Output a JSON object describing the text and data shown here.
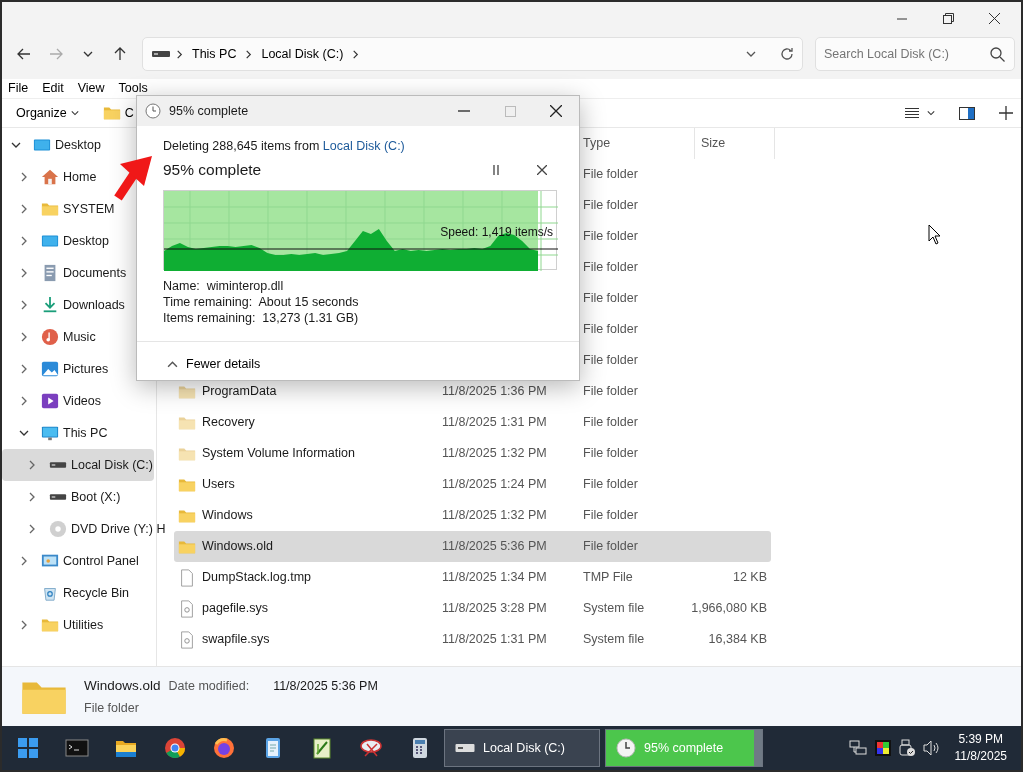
{
  "explorer": {
    "address": {
      "crumbs": [
        "This PC",
        "Local Disk (C:)"
      ]
    },
    "search": {
      "placeholder": "Search Local Disk (C:)"
    },
    "menu": [
      "File",
      "Edit",
      "View",
      "Tools"
    ],
    "command_bar": {
      "organize": "Organize",
      "partial_button": "C"
    },
    "sidebar": {
      "items": [
        {
          "label": "Desktop",
          "kind": "desktop",
          "expanded": true,
          "selected": false,
          "children": [
            {
              "label": "Home",
              "kind": "home",
              "expanded": false,
              "selected": false
            },
            {
              "label": "SYSTEM",
              "kind": "folder",
              "expanded": false,
              "selected": false
            },
            {
              "label": "Desktop",
              "kind": "desktop",
              "expanded": false,
              "selected": false
            },
            {
              "label": "Documents",
              "kind": "documents",
              "expanded": false,
              "selected": false
            },
            {
              "label": "Downloads",
              "kind": "downloads",
              "expanded": false,
              "selected": false
            },
            {
              "label": "Music",
              "kind": "music",
              "expanded": false,
              "selected": false
            },
            {
              "label": "Pictures",
              "kind": "pictures",
              "expanded": false,
              "selected": false
            },
            {
              "label": "Videos",
              "kind": "videos",
              "expanded": false,
              "selected": false
            },
            {
              "label": "This PC",
              "kind": "pc",
              "expanded": true,
              "selected": false,
              "children": [
                {
                  "label": "Local Disk (C:)",
                  "kind": "drive",
                  "expanded": false,
                  "selected": true
                },
                {
                  "label": "Boot (X:)",
                  "kind": "drive",
                  "expanded": false,
                  "selected": false
                },
                {
                  "label": "DVD Drive (Y:) H",
                  "kind": "dvd",
                  "expanded": false,
                  "selected": false
                }
              ]
            },
            {
              "label": "Control Panel",
              "kind": "control",
              "expanded": false,
              "selected": false
            },
            {
              "label": "Recycle Bin",
              "kind": "recycle",
              "selected": false
            },
            {
              "label": "Utilities",
              "kind": "folder",
              "expanded": false,
              "selected": false
            }
          ]
        }
      ]
    },
    "table": {
      "columns": [
        "Type",
        "Size"
      ],
      "rows": [
        {
          "type": "File folder",
          "selected": false
        },
        {
          "type": "File folder",
          "selected": false
        },
        {
          "type": "File folder",
          "selected": false
        },
        {
          "type": "File folder",
          "selected": false
        },
        {
          "type": "File folder",
          "selected": false
        },
        {
          "type": "File folder",
          "selected": false
        },
        {
          "type": "File folder",
          "selected": false
        },
        {
          "name": "ProgramData",
          "kind": "folder-faded",
          "date": "11/8/2025 1:36 PM",
          "type": "File folder",
          "selected": false
        },
        {
          "name": "Recovery",
          "kind": "folder-faded",
          "date": "11/8/2025 1:31 PM",
          "type": "File folder",
          "selected": false
        },
        {
          "name": "System Volume Information",
          "kind": "folder-faded",
          "date": "11/8/2025 1:32 PM",
          "type": "File folder",
          "selected": false
        },
        {
          "name": "Users",
          "kind": "folder",
          "date": "11/8/2025 1:24 PM",
          "type": "File folder",
          "selected": false
        },
        {
          "name": "Windows",
          "kind": "folder",
          "date": "11/8/2025 1:32 PM",
          "type": "File folder",
          "selected": false
        },
        {
          "name": "Windows.old",
          "kind": "folder",
          "date": "11/8/2025 5:36 PM",
          "type": "File folder",
          "selected": true
        },
        {
          "name": "DumpStack.log.tmp",
          "kind": "file",
          "date": "11/8/2025 1:34 PM",
          "type": "TMP File",
          "size": "12 KB",
          "selected": false
        },
        {
          "name": "pagefile.sys",
          "kind": "sysfile",
          "date": "11/8/2025 3:28 PM",
          "type": "System file",
          "size": "1,966,080 KB",
          "selected": false
        },
        {
          "name": "swapfile.sys",
          "kind": "sysfile",
          "date": "11/8/2025 1:31 PM",
          "type": "System file",
          "size": "16,384 KB",
          "selected": false
        }
      ]
    },
    "details_pane": {
      "name": "Windows.old",
      "date_label": "Date modified:",
      "date": "11/8/2025 5:36 PM",
      "type": "File folder"
    }
  },
  "progress_dialog": {
    "title": "95% complete",
    "status": "Deleting 288,645 items from ",
    "source_link": "Local Disk (C:)",
    "heading": "95% complete",
    "level": 0.95,
    "speed": "Speed: 1,419 items/s",
    "details": [
      "Name:  wiminterop.dll",
      "Time remaining:  About 15 seconds",
      "Items remaining:  13,273 (1.31 GB)"
    ],
    "toggle": "Fewer details"
  },
  "taskbar": {
    "apps": [
      {
        "kind": "start"
      },
      {
        "kind": "terminal"
      },
      {
        "kind": "explorer"
      },
      {
        "kind": "chrome"
      },
      {
        "kind": "firefox"
      },
      {
        "kind": "notepad"
      },
      {
        "kind": "notepadpp"
      },
      {
        "kind": "snip"
      },
      {
        "kind": "calculator"
      }
    ],
    "tasks": [
      {
        "label": "Local Disk (C:)",
        "kind": "drive",
        "selected": false
      },
      {
        "label": "95% complete",
        "kind": "progress",
        "selected": true,
        "level": 0.95
      }
    ],
    "clock": {
      "time": "5:39 PM",
      "date": "11/8/2025"
    }
  }
}
